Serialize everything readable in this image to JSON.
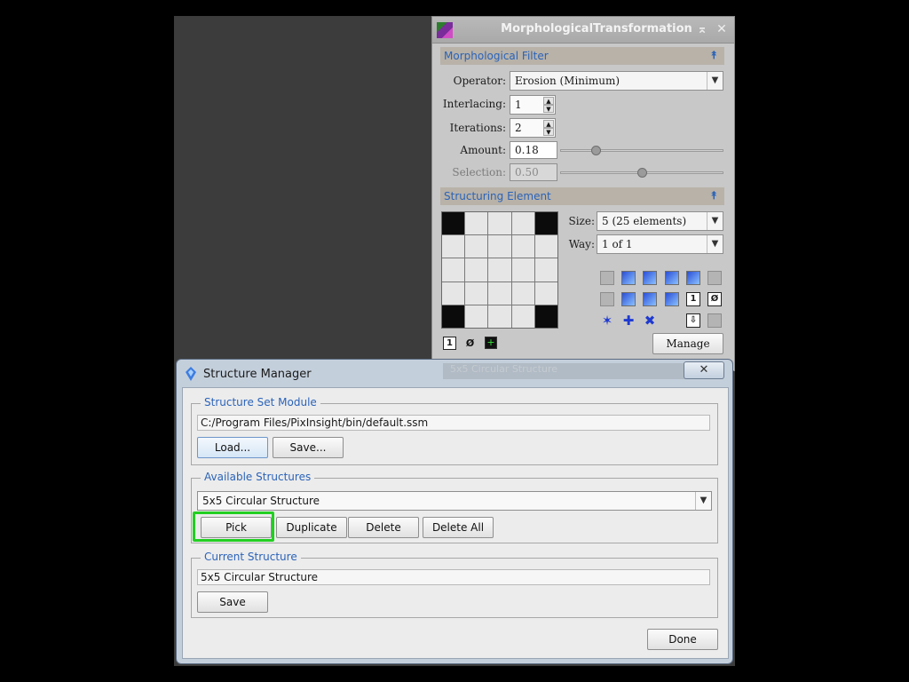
{
  "morph": {
    "title": "MorphologicalTransformation",
    "filter_header": "Morphological Filter",
    "operator_label": "Operator:",
    "operator_value": "Erosion (Minimum)",
    "interlacing_label": "Interlacing:",
    "interlacing_value": "1",
    "iterations_label": "Iterations:",
    "iterations_value": "2",
    "amount_label": "Amount:",
    "amount_value": "0.18",
    "amount_slider_fraction": 0.2,
    "selection_label": "Selection:",
    "selection_value": "0.50",
    "selection_slider_fraction": 0.5,
    "structuring_header": "Structuring Element",
    "size_label": "Size:",
    "size_value": "5  (25 elements)",
    "way_label": "Way:",
    "way_value": "1 of 1",
    "manage_label": "Manage",
    "grid": [
      [
        1,
        0,
        0,
        0,
        1
      ],
      [
        0,
        0,
        0,
        0,
        0
      ],
      [
        0,
        0,
        0,
        0,
        0
      ],
      [
        0,
        0,
        0,
        0,
        0
      ],
      [
        1,
        0,
        0,
        0,
        1
      ]
    ]
  },
  "dialog": {
    "title": "Structure Manager",
    "close_glyph": "✕",
    "set_module_legend": "Structure Set Module",
    "set_module_path": "C:/Program Files/PixInsight/bin/default.ssm",
    "load_label": "Load...",
    "save_label": "Save...",
    "available_legend": "Available Structures",
    "available_selected": "5x5 Circular Structure",
    "pick_label": "Pick",
    "duplicate_label": "Duplicate",
    "delete_label": "Delete",
    "delete_all_label": "Delete All",
    "current_legend": "Current Structure",
    "current_value": "5x5 Circular Structure",
    "current_save_label": "Save",
    "done_label": "Done",
    "hidden_behind_label": "5x5 Circular Structure"
  },
  "colors": {
    "accent_blue": "#2b63b8",
    "highlight_green": "#22cf22"
  }
}
